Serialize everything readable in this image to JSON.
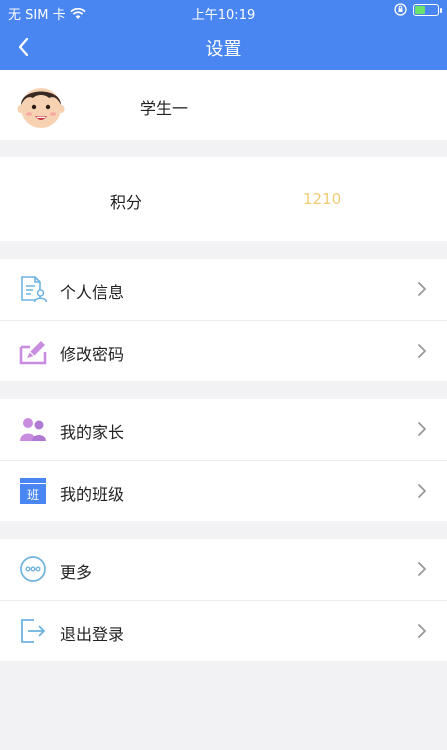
{
  "status_bar": {
    "carrier": "无 SIM 卡",
    "time": "上午10:19",
    "battery_level": 0.45
  },
  "nav": {
    "title": "设置"
  },
  "profile": {
    "name": "学生一"
  },
  "score": {
    "label": "积分",
    "value": "1210",
    "value_color": "#f2cc73"
  },
  "groups": [
    {
      "items": [
        {
          "label": "个人信息",
          "icon": "personal-info-icon"
        },
        {
          "label": "修改密码",
          "icon": "change-password-icon"
        }
      ]
    },
    {
      "items": [
        {
          "label": "我的家长",
          "icon": "parents-icon"
        },
        {
          "label": "我的班级",
          "icon": "class-icon",
          "icon_text": "班"
        }
      ]
    },
    {
      "items": [
        {
          "label": "更多",
          "icon": "more-icon"
        },
        {
          "label": "退出登录",
          "icon": "logout-icon"
        }
      ]
    }
  ],
  "colors": {
    "brand": "#4a86f2",
    "background": "#f2f2f4"
  }
}
